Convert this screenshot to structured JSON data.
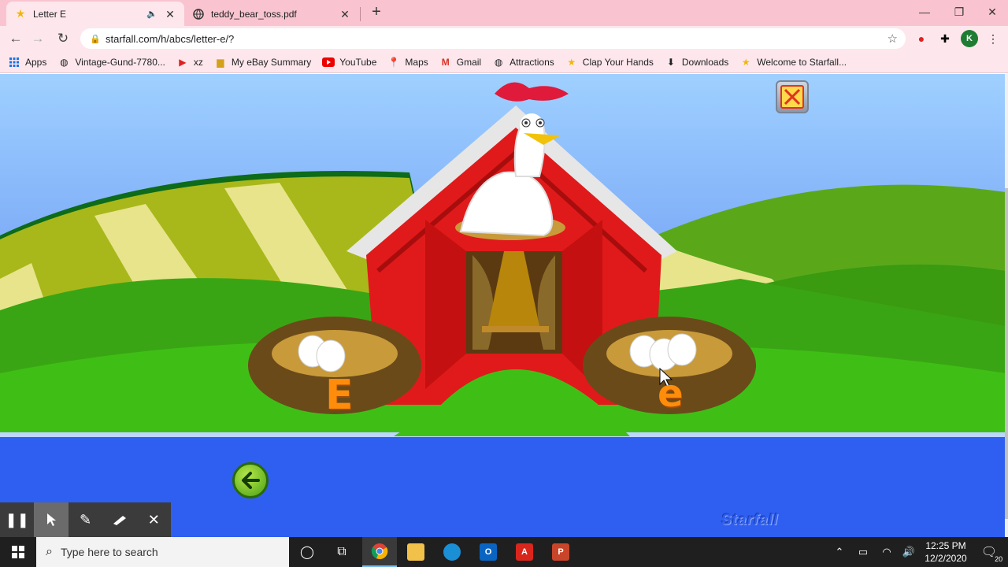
{
  "browser": {
    "tabs": [
      {
        "title": "Letter E",
        "favicon": "star-icon",
        "active": true,
        "audio": true
      },
      {
        "title": "teddy_bear_toss.pdf",
        "favicon": "globe-icon",
        "active": false
      }
    ],
    "url": "starfall.com/h/abcs/letter-e/?",
    "profile_initial": "K",
    "bookmarks": [
      {
        "label": "Apps",
        "icon": "apps-grid-icon"
      },
      {
        "label": "Vintage-Gund-7780...",
        "icon": "globe-icon"
      },
      {
        "label": "xz",
        "icon": "play-icon"
      },
      {
        "label": "My eBay Summary",
        "icon": "bag-icon"
      },
      {
        "label": "YouTube",
        "icon": "youtube-icon"
      },
      {
        "label": "Maps",
        "icon": "map-pin-icon"
      },
      {
        "label": "Gmail",
        "icon": "gmail-icon"
      },
      {
        "label": "Attractions",
        "icon": "globe-icon"
      },
      {
        "label": "Clap Your Hands",
        "icon": "star-icon"
      },
      {
        "label": "Downloads",
        "icon": "download-icon"
      },
      {
        "label": "Welcome to Starfall...",
        "icon": "star-icon"
      }
    ]
  },
  "game": {
    "left_nest_letter": "E",
    "right_nest_letter": "e",
    "brand": "Starfall"
  },
  "taskbar": {
    "search_placeholder": "Type here to search",
    "time": "12:25 PM",
    "date": "12/2/2020",
    "notifications": "20"
  }
}
